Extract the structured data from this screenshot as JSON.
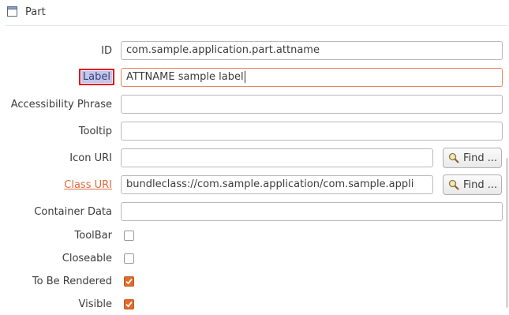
{
  "header": {
    "title": "Part",
    "icon": "window-icon"
  },
  "fields": {
    "id": {
      "label": "ID",
      "value": "com.sample.application.part.attname"
    },
    "label": {
      "label": "Label",
      "value": "ATTNAME sample label"
    },
    "accessibility": {
      "label": "Accessibility Phrase",
      "value": ""
    },
    "tooltip": {
      "label": "Tooltip",
      "value": ""
    },
    "icon_uri": {
      "label": "Icon URI",
      "value": "",
      "button": "Find ..."
    },
    "class_uri": {
      "label": "Class URI",
      "value": "bundleclass://com.sample.application/com.sample.appli",
      "button": "Find ..."
    },
    "container_data": {
      "label": "Container Data",
      "value": ""
    },
    "toolbar": {
      "label": "ToolBar",
      "checked": false
    },
    "closeable": {
      "label": "Closeable",
      "checked": false
    },
    "to_be_rendered": {
      "label": "To Be Rendered",
      "checked": true
    },
    "visible": {
      "label": "Visible",
      "checked": true
    }
  },
  "colors": {
    "accent": "#e06b2a",
    "link": "#e06b3c",
    "focus_outline": "#e3101c",
    "selection": "#c2c7ee"
  }
}
